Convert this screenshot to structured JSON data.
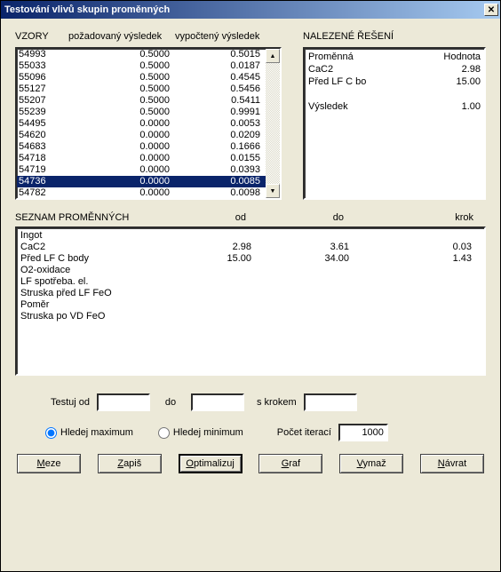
{
  "window": {
    "title": "Testování vlivů skupin proměnných"
  },
  "headers": {
    "vzory": "VZORY",
    "pozadovany": "požadovaný výsledek",
    "vypocteny": "vypočtený výsledek",
    "nalezene": "NALEZENÉ ŘEŠENÍ",
    "seznam": "SEZNAM PROMĚNNÝCH",
    "od": "od",
    "do": "do",
    "krok": "krok"
  },
  "vzory": [
    {
      "id": "54993",
      "req": "0.5000",
      "calc": "0.5015"
    },
    {
      "id": "55033",
      "req": "0.5000",
      "calc": "0.0187"
    },
    {
      "id": "55096",
      "req": "0.5000",
      "calc": "0.4545"
    },
    {
      "id": "55127",
      "req": "0.5000",
      "calc": "0.5456"
    },
    {
      "id": "55207",
      "req": "0.5000",
      "calc": "0.5411"
    },
    {
      "id": "55239",
      "req": "0.5000",
      "calc": "0.9991"
    },
    {
      "id": "54495",
      "req": "0.0000",
      "calc": "0.0053"
    },
    {
      "id": "54620",
      "req": "0.0000",
      "calc": "0.0209"
    },
    {
      "id": "54683",
      "req": "0.0000",
      "calc": "0.1666"
    },
    {
      "id": "54718",
      "req": "0.0000",
      "calc": "0.0155"
    },
    {
      "id": "54719",
      "req": "0.0000",
      "calc": "0.0393"
    },
    {
      "id": "54736",
      "req": "0.0000",
      "calc": "0.0085",
      "selected": true
    },
    {
      "id": "54782",
      "req": "0.0000",
      "calc": "0.0098"
    }
  ],
  "reseni": {
    "h1": "Proměnná",
    "h2": "Hodnota",
    "rows": [
      {
        "name": "CaC2",
        "value": "2.98"
      },
      {
        "name": "Před LF C bo",
        "value": "15.00"
      }
    ],
    "result_label": "Výsledek",
    "result_value": "1.00"
  },
  "variables": [
    {
      "name": "Ingot",
      "od": "",
      "do": "",
      "krok": ""
    },
    {
      "name": "CaC2",
      "od": "2.98",
      "do": "3.61",
      "krok": "0.03"
    },
    {
      "name": "Před LF C body",
      "od": "15.00",
      "do": "34.00",
      "krok": "1.43"
    },
    {
      "name": "O2-oxidace",
      "od": "",
      "do": "",
      "krok": ""
    },
    {
      "name": "LF spotřeba. el.",
      "od": "",
      "do": "",
      "krok": ""
    },
    {
      "name": "Struska před LF FeO",
      "od": "",
      "do": "",
      "krok": ""
    },
    {
      "name": "Poměr",
      "od": "",
      "do": "",
      "krok": ""
    },
    {
      "name": "Struska po VD FeO",
      "od": "",
      "do": "",
      "krok": ""
    }
  ],
  "controls": {
    "testuj_od": "Testuj od",
    "do": "do",
    "s_krokem": "s krokem",
    "hledej_max": "Hledej maximum",
    "hledej_min": "Hledej minimum",
    "pocet_iteraci": "Počet iterací",
    "iter_value": "1000"
  },
  "buttons": {
    "meze": "Meze",
    "zapis": "Zapiš",
    "optimalizuj": "Optimalizuj",
    "graf": "Graf",
    "vymaz": "Vymaž",
    "navrat": "Návrat"
  }
}
